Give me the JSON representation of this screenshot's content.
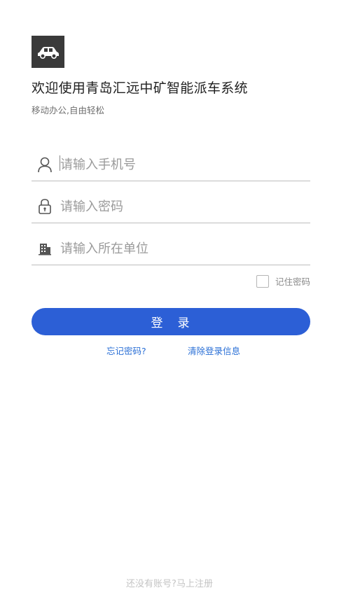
{
  "header": {
    "logo_icon": "car-icon",
    "title": "欢迎使用青岛汇远中矿智能派车系统",
    "subtitle": "移动办公,自由轻松"
  },
  "form": {
    "phone": {
      "icon": "user-icon",
      "placeholder": "请输入手机号",
      "value": ""
    },
    "password": {
      "icon": "lock-icon",
      "placeholder": "请输入密码",
      "value": ""
    },
    "unit": {
      "icon": "building-icon",
      "placeholder": "请输入所在单位",
      "value": ""
    },
    "remember_label": "记住密码",
    "remember_checked": false
  },
  "actions": {
    "login_label": "登　录",
    "forgot_label": "忘记密码?",
    "clear_label": "清除登录信息"
  },
  "footer": {
    "register_label": "还没有账号?马上注册"
  },
  "colors": {
    "primary": "#2c5fd6",
    "link": "#2a6fd6",
    "logo_bg": "#3a3a3a"
  }
}
